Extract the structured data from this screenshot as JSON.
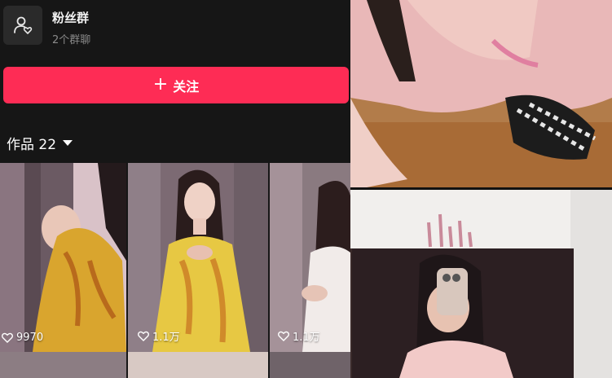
{
  "fan_group": {
    "title": "粉丝群",
    "subtitle": "2个群聊",
    "icon": "group-chat-icon"
  },
  "follow_button": {
    "label": "关注",
    "icon": "plus-icon",
    "color": "#fe2c55"
  },
  "works": {
    "label": "作品 22"
  },
  "videos": [
    {
      "likes": "9970"
    },
    {
      "likes": "1.1万"
    },
    {
      "likes": "1.1万"
    }
  ]
}
